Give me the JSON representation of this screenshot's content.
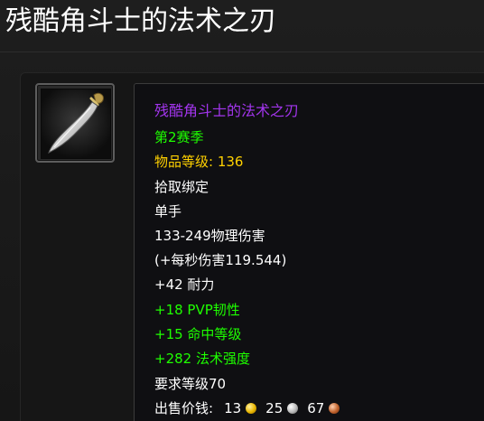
{
  "page": {
    "title": "残酷角斗士的法术之刃"
  },
  "item": {
    "icon": "dagger-icon",
    "name": "残酷角斗士的法术之刃",
    "season": "第2赛季",
    "item_level_label": "物品等级:",
    "item_level_value": "136",
    "binding": "拾取绑定",
    "slot": "单手",
    "damage": "133-249物理伤害",
    "dps": "(+每秒伤害119.544)",
    "stats": [
      "+42 耐力",
      "+18 PVP韧性",
      "+15 命中等级",
      "+282 法术强度"
    ],
    "requires_level": "要求等级70",
    "sell_price": {
      "label": "出售价钱:",
      "gold": "13",
      "silver": "25",
      "copper": "67"
    }
  },
  "colors": {
    "epic": "#a335ee",
    "green": "#1eff00",
    "gold": "#ffd100",
    "white": "#ffffff"
  }
}
